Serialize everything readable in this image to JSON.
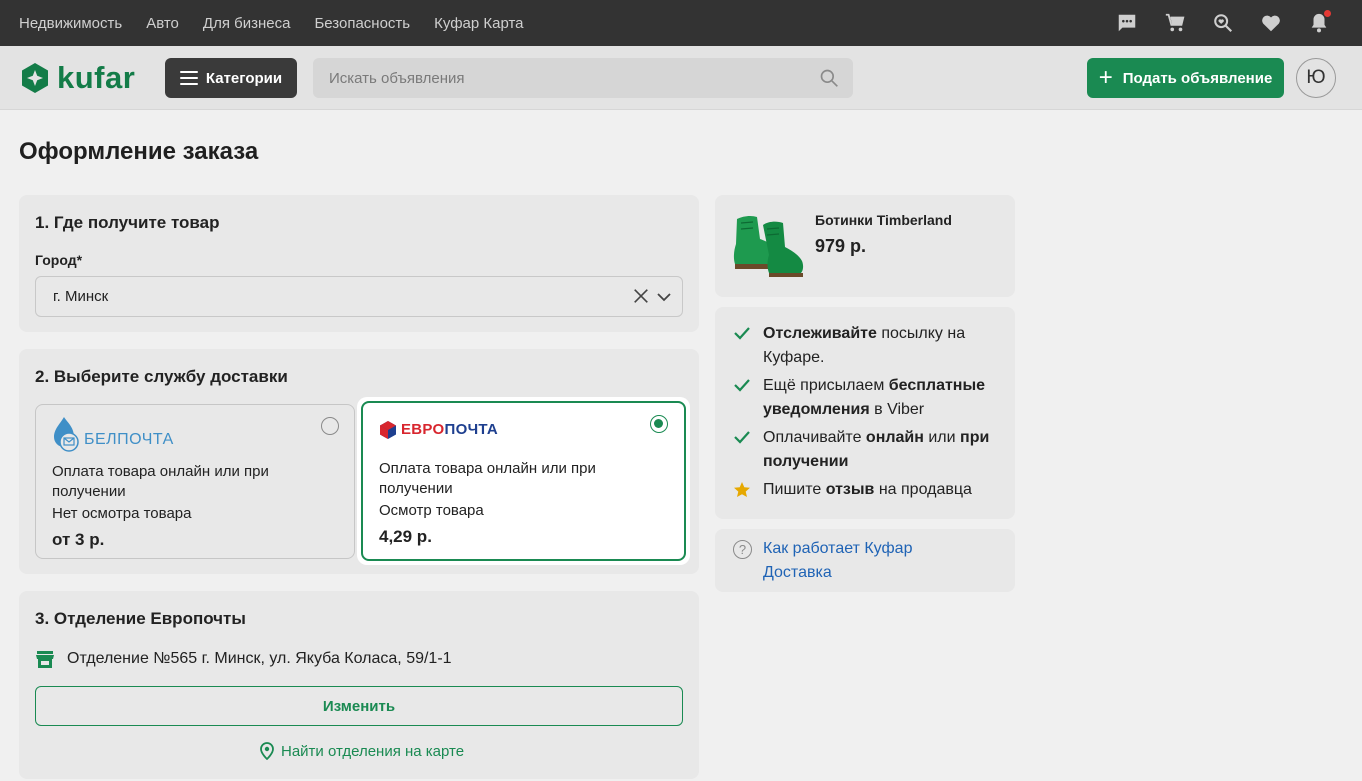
{
  "topbar": {
    "nav": [
      "Недвижимость",
      "Авто",
      "Для бизнеса",
      "Безопасность",
      "Куфар Карта"
    ],
    "icons": [
      "chat-icon",
      "cart-icon",
      "saved-search-icon",
      "heart-icon",
      "bell-icon"
    ]
  },
  "header": {
    "logo_text": "kufar",
    "categories_label": "Категории",
    "search_placeholder": "Искать объявления",
    "post_label": "Подать объявление",
    "avatar_letter": "Ю"
  },
  "page": {
    "title": "Оформление заказа"
  },
  "section1": {
    "title": "1. Где получите товар",
    "city_label": "Город*",
    "city_value": "г. Минск"
  },
  "section2": {
    "title": "2. Выберите службу доставки",
    "options": [
      {
        "logo_text": "БЕЛПОЧТА",
        "payment": "Оплата товара онлайн или при получении",
        "inspection": "Нет осмотра товара",
        "price": "от 3 р.",
        "selected": false
      },
      {
        "logo_part1": "ЕВРО",
        "logo_part2": "ПОЧТА",
        "payment": "Оплата товара онлайн или при получении",
        "inspection": "Осмотр товара",
        "price": "4,29 р.",
        "selected": true
      }
    ]
  },
  "section3": {
    "title": "3. Отделение Европочты",
    "office": "Отделение №565 г. Минск, ул. Якуба Коласа, 59/1-1",
    "change_label": "Изменить",
    "map_link": "Найти отделения на карте"
  },
  "product": {
    "name": "Ботинки Timberland",
    "price": "979 р."
  },
  "benefits": {
    "b1_bold": "Отслеживайте",
    "b1_rest": " посылку на Куфаре.",
    "b2_pre": "Ещё присылаем ",
    "b2_bold": "бесплатные уведомления",
    "b2_rest": " в Viber",
    "b3_pre": "Оплачивайте ",
    "b3_bold1": "онлайн",
    "b3_mid": " или ",
    "b3_bold2": "при получении",
    "b4_pre": "Пишите ",
    "b4_bold": "отзыв",
    "b4_rest": " на продавца"
  },
  "help": {
    "link": "Как работает Куфар Доставка"
  },
  "colors": {
    "brand_green": "#1a8a52",
    "link_blue": "#1f63b5",
    "topbar": "#333333"
  }
}
